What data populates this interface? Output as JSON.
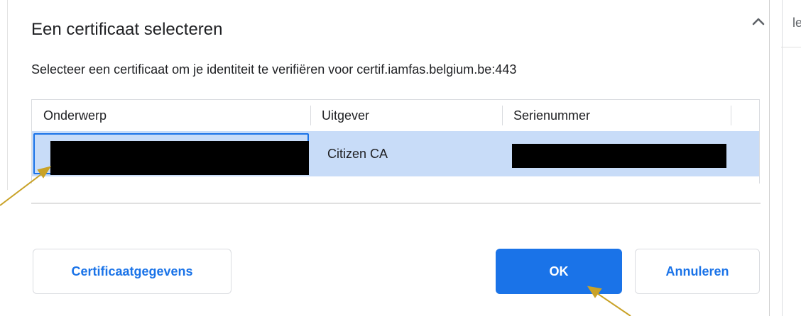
{
  "background": {
    "partial_text": "ler"
  },
  "dialog": {
    "title": "Een certificaat selecteren",
    "subtitle": "Selecteer een certificaat om je identiteit te verifiëren voor certif.iamfas.belgium.be:443",
    "close_icon": "close-icon",
    "table": {
      "columns": [
        "Onderwerp",
        "Uitgever",
        "Serienummer"
      ],
      "rows": [
        {
          "subject": "",
          "issuer": "Citizen CA",
          "serial": "",
          "subject_redacted": true,
          "serial_redacted": true,
          "selected": true
        }
      ]
    },
    "buttons": {
      "details": "Certificaatgegevens",
      "ok": "OK",
      "cancel": "Annuleren"
    }
  },
  "colors": {
    "accent": "#1a73e8",
    "selection": "#c8dcf8",
    "annotation_arrow": "#c9a227"
  }
}
